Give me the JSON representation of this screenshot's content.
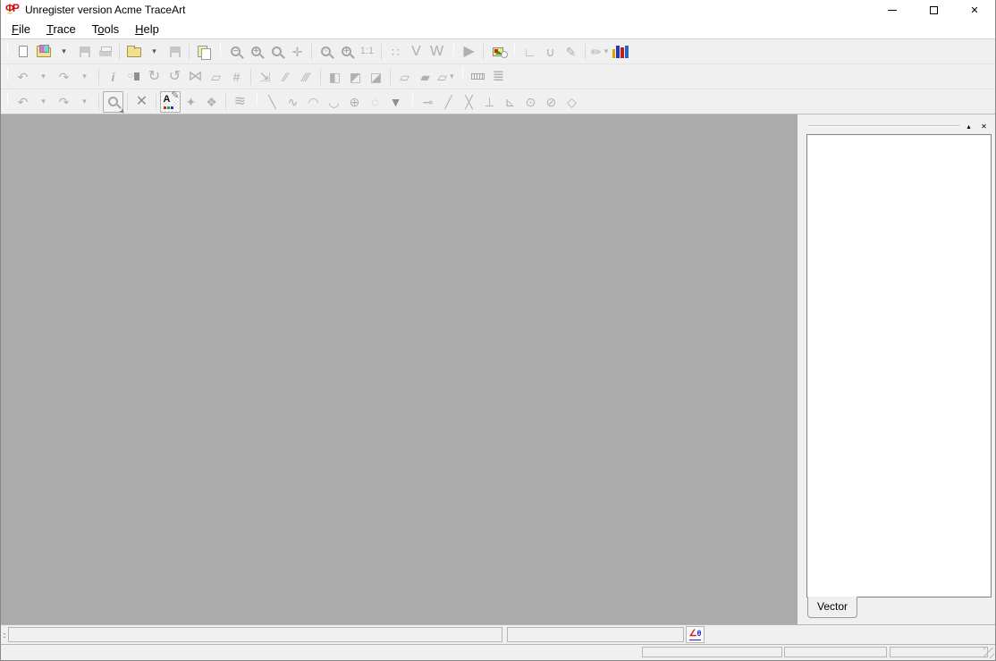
{
  "window": {
    "title": "Unregister version Acme TraceArt",
    "icon_red_text": "ΦP",
    "icon_yellow_text": "~"
  },
  "menu": {
    "items": [
      {
        "pre": "",
        "key": "F",
        "post": "ile"
      },
      {
        "pre": "",
        "key": "T",
        "post": "race"
      },
      {
        "pre": "T",
        "key": "o",
        "post": "ols"
      },
      {
        "pre": "",
        "key": "H",
        "post": "elp"
      }
    ]
  },
  "icons": {
    "dropdown": "▾",
    "undo": "↶",
    "redo": "↷",
    "mag_minus": "−",
    "mag_plus": "+",
    "pan": "✛",
    "zoom_1to1": "1:1",
    "select_grid": "∷",
    "view_v": "V",
    "view_w": "W",
    "play": "▶",
    "corner": "∟",
    "magnet": "∪",
    "pin": "✎",
    "brush": "✏",
    "info": "i",
    "rotate_cw": "↻",
    "rotate_ccw": "↺",
    "flip": "⋈",
    "skew": "▱",
    "crop": "#",
    "resample": "⇲",
    "hatch": "∕∕",
    "hatch_dense": "∕∕∕",
    "fill_1": "◧",
    "fill_2": "◩",
    "fill_3": "◪",
    "erase_1": "▱",
    "erase_2": "▰",
    "erase_3": "▱",
    "script": "≣",
    "delete": "✕",
    "wand": "✦",
    "nodes": "❖",
    "layers": "≋",
    "a_letter": "A",
    "pen": "✎",
    "binarize_circle": "○",
    "cursor": "➤",
    "line": "╲",
    "polyline": "∿",
    "arc": "◠",
    "curve": "◡",
    "circle_add": "⊕",
    "ellipse": "◌",
    "triangle": "▼",
    "endpoint": "⊸",
    "segment": "╱",
    "intersect": "╳",
    "perpendicular": "⊥",
    "angle_snap": "⊾",
    "center": "⊙",
    "tangent": "⊘",
    "quadrant": "◇",
    "panel_collapse": "▴",
    "panel_close": "✕",
    "window_close": "✕",
    "angle_mark": "∠",
    "theta": "θ"
  },
  "panel": {
    "tab_label": "Vector"
  },
  "statusbar": {
    "left_mark": ":"
  },
  "colors": {
    "canvas_gray": "#ababab",
    "chrome_bg": "#f0f0f0",
    "titlebar_bg": "#ffffff",
    "brand_red": "#cc1111",
    "brand_yellow": "#e8c400",
    "disabled_icon": "#b0b0b0"
  }
}
